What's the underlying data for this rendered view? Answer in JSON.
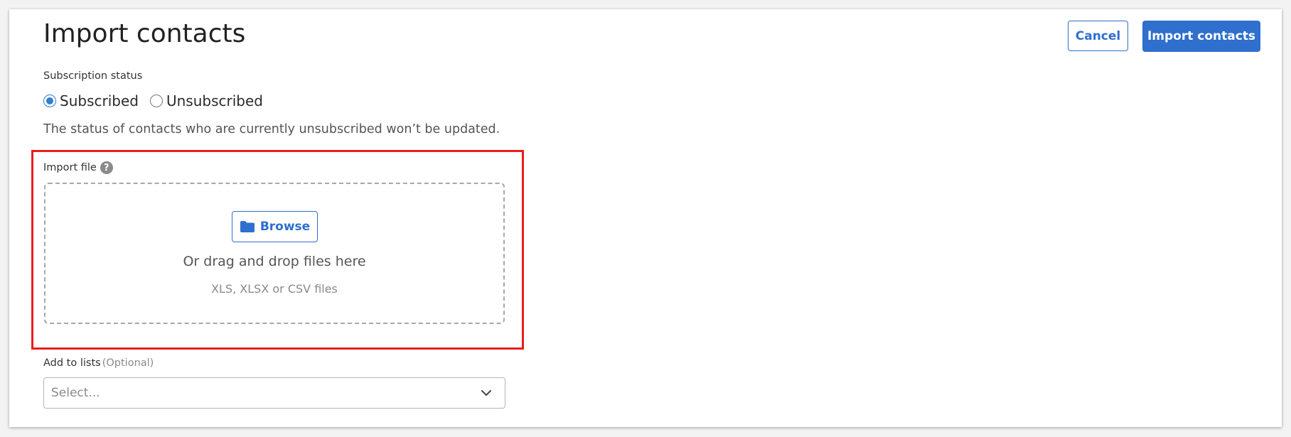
{
  "header": {
    "title": "Import contacts",
    "cancel_label": "Cancel",
    "import_label": "Import contacts"
  },
  "subscription": {
    "label": "Subscription status",
    "options": [
      {
        "label": "Subscribed",
        "checked": true
      },
      {
        "label": "Unsubscribed",
        "checked": false
      }
    ],
    "note": "The status of contacts who are currently unsubscribed won’t be updated."
  },
  "import_file": {
    "label": "Import file",
    "help_icon": "help-icon",
    "browse_label": "Browse",
    "browse_icon": "folder-icon",
    "drag_text": "Or drag and drop files here",
    "file_types": "XLS, XLSX or CSV files"
  },
  "lists": {
    "label": "Add to lists",
    "optional": "(Optional)",
    "placeholder": "Select...",
    "dropdown_icon": "chevron-down-icon"
  },
  "colors": {
    "accent": "#2f6fce",
    "highlight": "#ea1d1d",
    "radio": "#2f7fd1"
  }
}
